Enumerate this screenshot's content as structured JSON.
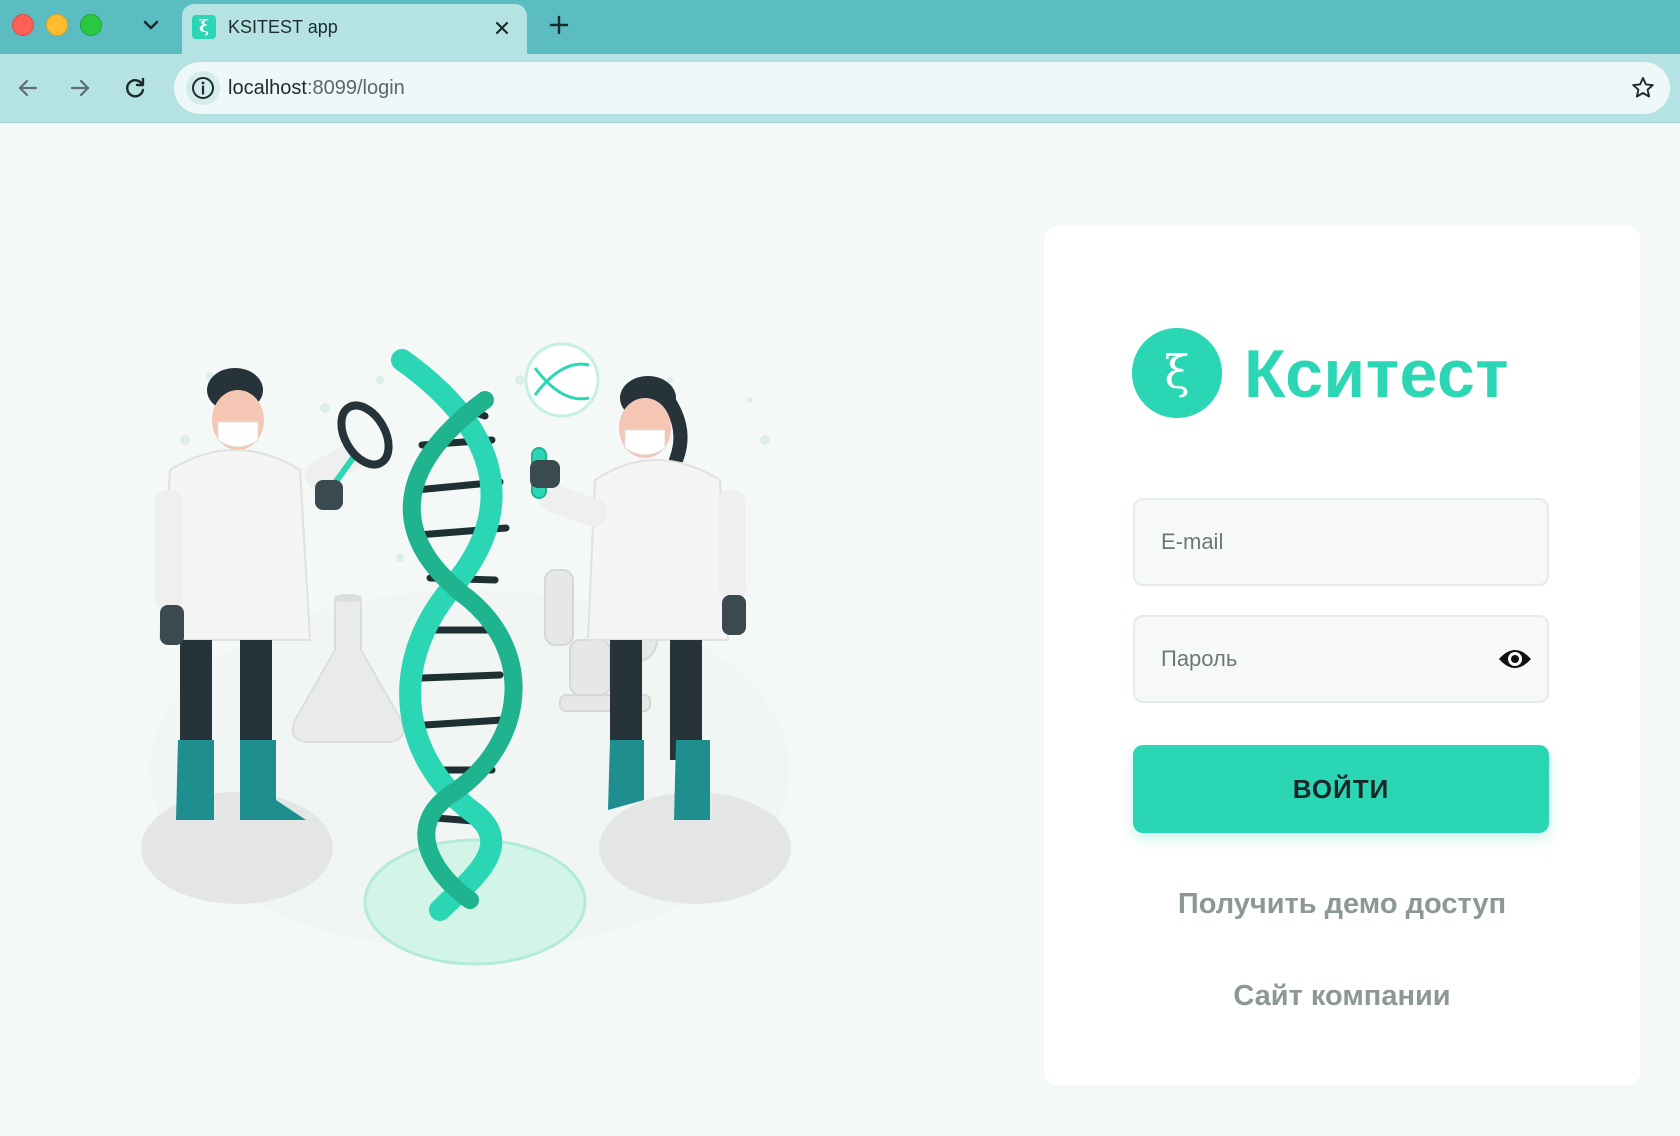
{
  "browser": {
    "tab": {
      "title": "KSITEST app",
      "favicon": "ξ"
    },
    "url": {
      "host": "localhost",
      "rest": ":8099/login"
    }
  },
  "login": {
    "brand": "Кситест",
    "brand_symbol": "ξ",
    "email_placeholder": "E-mail",
    "password_placeholder": "Пароль",
    "submit_label": "ВОЙТИ",
    "demo_link": "Получить демо доступ",
    "company_link": "Сайт компании"
  },
  "colors": {
    "accent": "#2bd6b4",
    "tabbar": "#5bbcc1",
    "toolbar": "#b5e3e4",
    "page_bg": "#f4f8f7"
  }
}
